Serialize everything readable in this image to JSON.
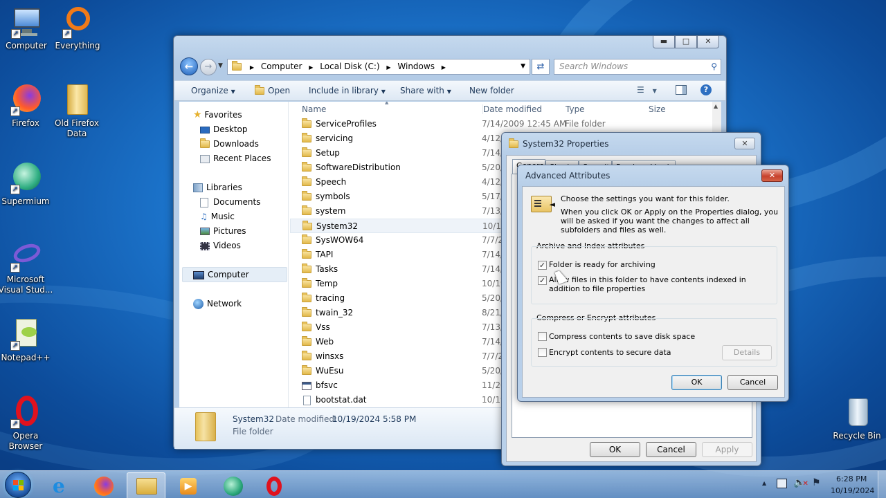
{
  "desktop": {
    "icons": [
      {
        "label": "Computer",
        "kind": "computer"
      },
      {
        "label": "Everything",
        "kind": "everything"
      },
      {
        "label": "Firefox",
        "kind": "firefox"
      },
      {
        "label": "Old Firefox Data",
        "kind": "folder"
      },
      {
        "label": "Supermium",
        "kind": "supermium"
      },
      {
        "label": "Microsoft Visual Stud...",
        "kind": "vs"
      },
      {
        "label": "Notepad++",
        "kind": "notepad"
      },
      {
        "label": "Opera Browser",
        "kind": "opera"
      },
      {
        "label": "Recycle Bin",
        "kind": "bin"
      }
    ]
  },
  "explorer": {
    "breadcrumb": [
      "Computer",
      "Local Disk (C:)",
      "Windows"
    ],
    "search_placeholder": "Search Windows",
    "toolbar": {
      "organize": "Organize",
      "open": "Open",
      "include": "Include in library",
      "share": "Share with",
      "newfolder": "New folder"
    },
    "nav": {
      "favorites": "Favorites",
      "desktop": "Desktop",
      "downloads": "Downloads",
      "recent": "Recent Places",
      "libraries": "Libraries",
      "documents": "Documents",
      "music": "Music",
      "pictures": "Pictures",
      "videos": "Videos",
      "computer": "Computer",
      "network": "Network"
    },
    "columns": {
      "name": "Name",
      "date": "Date modified",
      "type": "Type",
      "size": "Size"
    },
    "files": [
      {
        "name": "ServiceProfiles",
        "date": "7/14/2009 12:45 AM",
        "type": "File folder",
        "icon": "folder"
      },
      {
        "name": "servicing",
        "date": "4/12/",
        "type": "",
        "icon": "folder"
      },
      {
        "name": "Setup",
        "date": "7/14/",
        "type": "",
        "icon": "folder"
      },
      {
        "name": "SoftwareDistribution",
        "date": "5/20/",
        "type": "",
        "icon": "folder"
      },
      {
        "name": "Speech",
        "date": "4/12/",
        "type": "",
        "icon": "folder"
      },
      {
        "name": "symbols",
        "date": "5/17/",
        "type": "",
        "icon": "folder"
      },
      {
        "name": "system",
        "date": "7/13/",
        "type": "",
        "icon": "folder"
      },
      {
        "name": "System32",
        "date": "10/19",
        "type": "",
        "icon": "folder"
      },
      {
        "name": "SysWOW64",
        "date": "7/7/2",
        "type": "",
        "icon": "folder"
      },
      {
        "name": "TAPI",
        "date": "7/14/",
        "type": "",
        "icon": "folder"
      },
      {
        "name": "Tasks",
        "date": "7/14/",
        "type": "",
        "icon": "folder"
      },
      {
        "name": "Temp",
        "date": "10/19",
        "type": "",
        "icon": "folder"
      },
      {
        "name": "tracing",
        "date": "5/20/",
        "type": "",
        "icon": "folder"
      },
      {
        "name": "twain_32",
        "date": "8/21/",
        "type": "",
        "icon": "folder"
      },
      {
        "name": "Vss",
        "date": "7/13/",
        "type": "",
        "icon": "folder"
      },
      {
        "name": "Web",
        "date": "7/14/",
        "type": "",
        "icon": "folder"
      },
      {
        "name": "winsxs",
        "date": "7/7/2",
        "type": "",
        "icon": "folder"
      },
      {
        "name": "WuEsu",
        "date": "5/20/",
        "type": "",
        "icon": "folder"
      },
      {
        "name": "bfsvc",
        "date": "11/20",
        "type": "",
        "icon": "exe"
      },
      {
        "name": "bootstat.dat",
        "date": "10/19",
        "type": "",
        "icon": "file"
      }
    ],
    "details": {
      "name": "System32",
      "date_label": "Date modified:",
      "date": "10/19/2024 5:58 PM",
      "type": "File folder"
    }
  },
  "props": {
    "title": "System32 Properties",
    "tabs": [
      "General",
      "Sharing",
      "Security",
      "Previous Versions"
    ],
    "ok": "OK",
    "cancel": "Cancel",
    "apply": "Apply"
  },
  "adv": {
    "title": "Advanced Attributes",
    "intro": "Choose the settings you want for this folder.",
    "intro2": "When you click OK or Apply on the Properties dialog, you will be asked if you want the changes to affect all subfolders and files as well.",
    "group1": "Archive and Index attributes",
    "archive": "Folder is ready for archiving",
    "index": "Allow files in this folder to have contents indexed in addition to file properties",
    "group2": "Compress or Encrypt attributes",
    "compress": "Compress contents to save disk space",
    "encrypt": "Encrypt contents to secure data",
    "details": "Details",
    "ok": "OK",
    "cancel": "Cancel"
  },
  "taskbar": {
    "time": "6:28 PM",
    "date": "10/19/2024"
  }
}
